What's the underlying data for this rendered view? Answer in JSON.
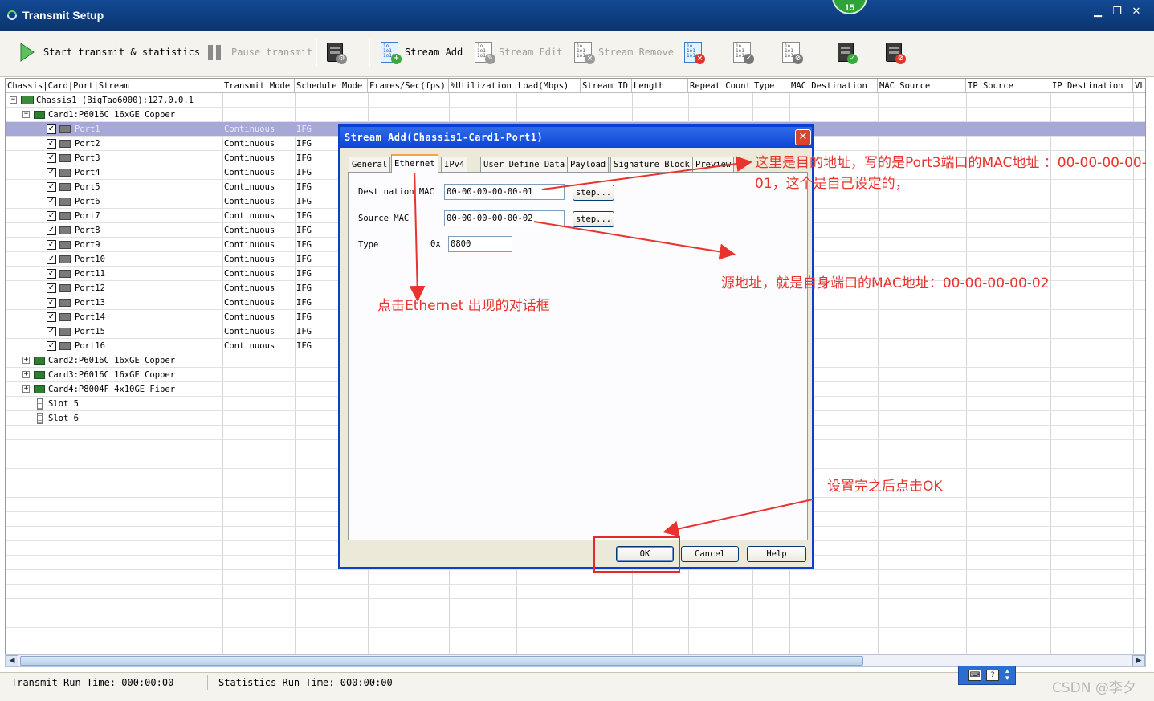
{
  "window": {
    "title": "Transmit Setup",
    "badge": "15",
    "controls": [
      "minimize",
      "restore",
      "close"
    ]
  },
  "toolbar": {
    "start_label": "Start transmit & statistics",
    "pause_label": "Pause transmit",
    "stream_add_label": "Stream Add",
    "stream_edit_label": "Stream Edit",
    "stream_remove_label": "Stream Remove"
  },
  "grid": {
    "columns": [
      "Chassis|Card|Port|Stream",
      "Transmit Mode",
      "Schedule Mode",
      "Frames/Sec(fps)",
      "%Utilization",
      "Load(Mbps)",
      "Stream ID",
      "Length",
      "Repeat Count",
      "Type",
      "MAC Destination",
      "MAC Source",
      "IP Source",
      "IP Destination",
      "VL"
    ],
    "chassis": "Chassis1 (BigTao6000):127.0.0.1",
    "card1": "Card1:P6016C 16xGE Copper",
    "ports": [
      {
        "name": "Port1",
        "mode": "Continuous",
        "schedule": "IFG"
      },
      {
        "name": "Port2",
        "mode": "Continuous",
        "schedule": "IFG"
      },
      {
        "name": "Port3",
        "mode": "Continuous",
        "schedule": "IFG"
      },
      {
        "name": "Port4",
        "mode": "Continuous",
        "schedule": "IFG"
      },
      {
        "name": "Port5",
        "mode": "Continuous",
        "schedule": "IFG"
      },
      {
        "name": "Port6",
        "mode": "Continuous",
        "schedule": "IFG"
      },
      {
        "name": "Port7",
        "mode": "Continuous",
        "schedule": "IFG"
      },
      {
        "name": "Port8",
        "mode": "Continuous",
        "schedule": "IFG"
      },
      {
        "name": "Port9",
        "mode": "Continuous",
        "schedule": "IFG"
      },
      {
        "name": "Port10",
        "mode": "Continuous",
        "schedule": "IFG"
      },
      {
        "name": "Port11",
        "mode": "Continuous",
        "schedule": "IFG"
      },
      {
        "name": "Port12",
        "mode": "Continuous",
        "schedule": "IFG"
      },
      {
        "name": "Port13",
        "mode": "Continuous",
        "schedule": "IFG"
      },
      {
        "name": "Port14",
        "mode": "Continuous",
        "schedule": "IFG"
      },
      {
        "name": "Port15",
        "mode": "Continuous",
        "schedule": "IFG"
      },
      {
        "name": "Port16",
        "mode": "Continuous",
        "schedule": "IFG"
      }
    ],
    "card2": "Card2:P6016C 16xGE Copper",
    "card3": "Card3:P6016C 16xGE Copper",
    "card4": "Card4:P8004F 4x10GE Fiber",
    "slot5": "Slot 5",
    "slot6": "Slot 6"
  },
  "status": {
    "transmit_run_time": "Transmit Run Time: 000:00:00",
    "statistics_run_time": "Statistics Run Time: 000:00:00"
  },
  "dialog": {
    "title": "Stream Add(Chassis1-Card1-Port1)",
    "tabs": [
      "General",
      "Ethernet",
      "IPv4",
      "User Define Data",
      "Payload",
      "Signature Block",
      "Preview"
    ],
    "active_tab": "Ethernet",
    "dest_mac_label": "Destination MAC",
    "dest_mac_value": "00-00-00-00-00-01",
    "src_mac_label": "Source MAC",
    "src_mac_value": "00-00-00-00-00-02",
    "step_label": "step...",
    "type_label": "Type",
    "type_prefix": "0x",
    "type_value": "0800",
    "ok_label": "OK",
    "cancel_label": "Cancel",
    "help_label": "Help"
  },
  "annotations": {
    "dest_note": "这里是目的地址，写的是Port3端口的MAC地址 ：00-00-00-00-01，这个是自己设定的，",
    "src_note": "源地址，就是自身端口的MAC地址：00-00-00-00-02",
    "ethernet_note": "点击Ethernet 出现的对话框",
    "ok_note": "设置完之后点击OK"
  },
  "watermark": "CSDN @李夕",
  "colors": {
    "titlebar": "#0b3470",
    "dialog_border": "#0a3fd0",
    "annotation": "#e8332f",
    "selected_row": "#a8a8d8"
  }
}
